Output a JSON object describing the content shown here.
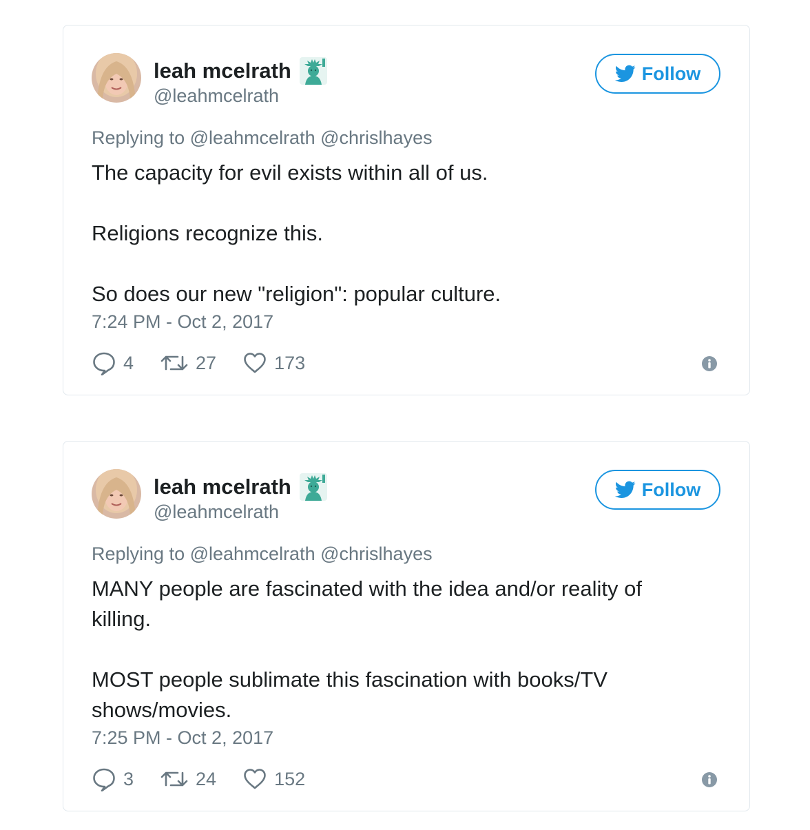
{
  "tweets": [
    {
      "display_name": "leah mcelrath",
      "handle": "@leahmcelrath",
      "follow_label": "Follow",
      "reply_prefix": "Replying to",
      "reply_to": [
        "@leahmcelrath",
        "@chrislhayes"
      ],
      "paragraphs": [
        "The capacity for evil exists within all of us.",
        "Religions recognize this.",
        "So does our new \"religion\": popular culture."
      ],
      "timestamp": "7:24 PM - Oct 2, 2017",
      "replies": "4",
      "retweets": "27",
      "likes": "173"
    },
    {
      "display_name": "leah mcelrath",
      "handle": "@leahmcelrath",
      "follow_label": "Follow",
      "reply_prefix": "Replying to",
      "reply_to": [
        "@leahmcelrath",
        "@chrislhayes"
      ],
      "paragraphs": [
        "MANY people are fascinated with the idea and/or reality of killing.",
        "MOST people sublimate this fascination with books/TV shows/movies."
      ],
      "timestamp": "7:25 PM - Oct 2, 2017",
      "replies": "3",
      "retweets": "24",
      "likes": "152"
    }
  ],
  "colors": {
    "accent": "#1b95e0",
    "secondary_text": "#697882",
    "primary_text": "#1c2022",
    "border": "#e1e8ed",
    "liberty_green": "#3eaa97"
  },
  "icons": {
    "name_emoji": "statue-of-liberty-icon",
    "follow": "twitter-bird-icon",
    "reply": "reply-bubble-icon",
    "retweet": "retweet-icon",
    "like": "heart-icon",
    "info": "info-icon"
  }
}
